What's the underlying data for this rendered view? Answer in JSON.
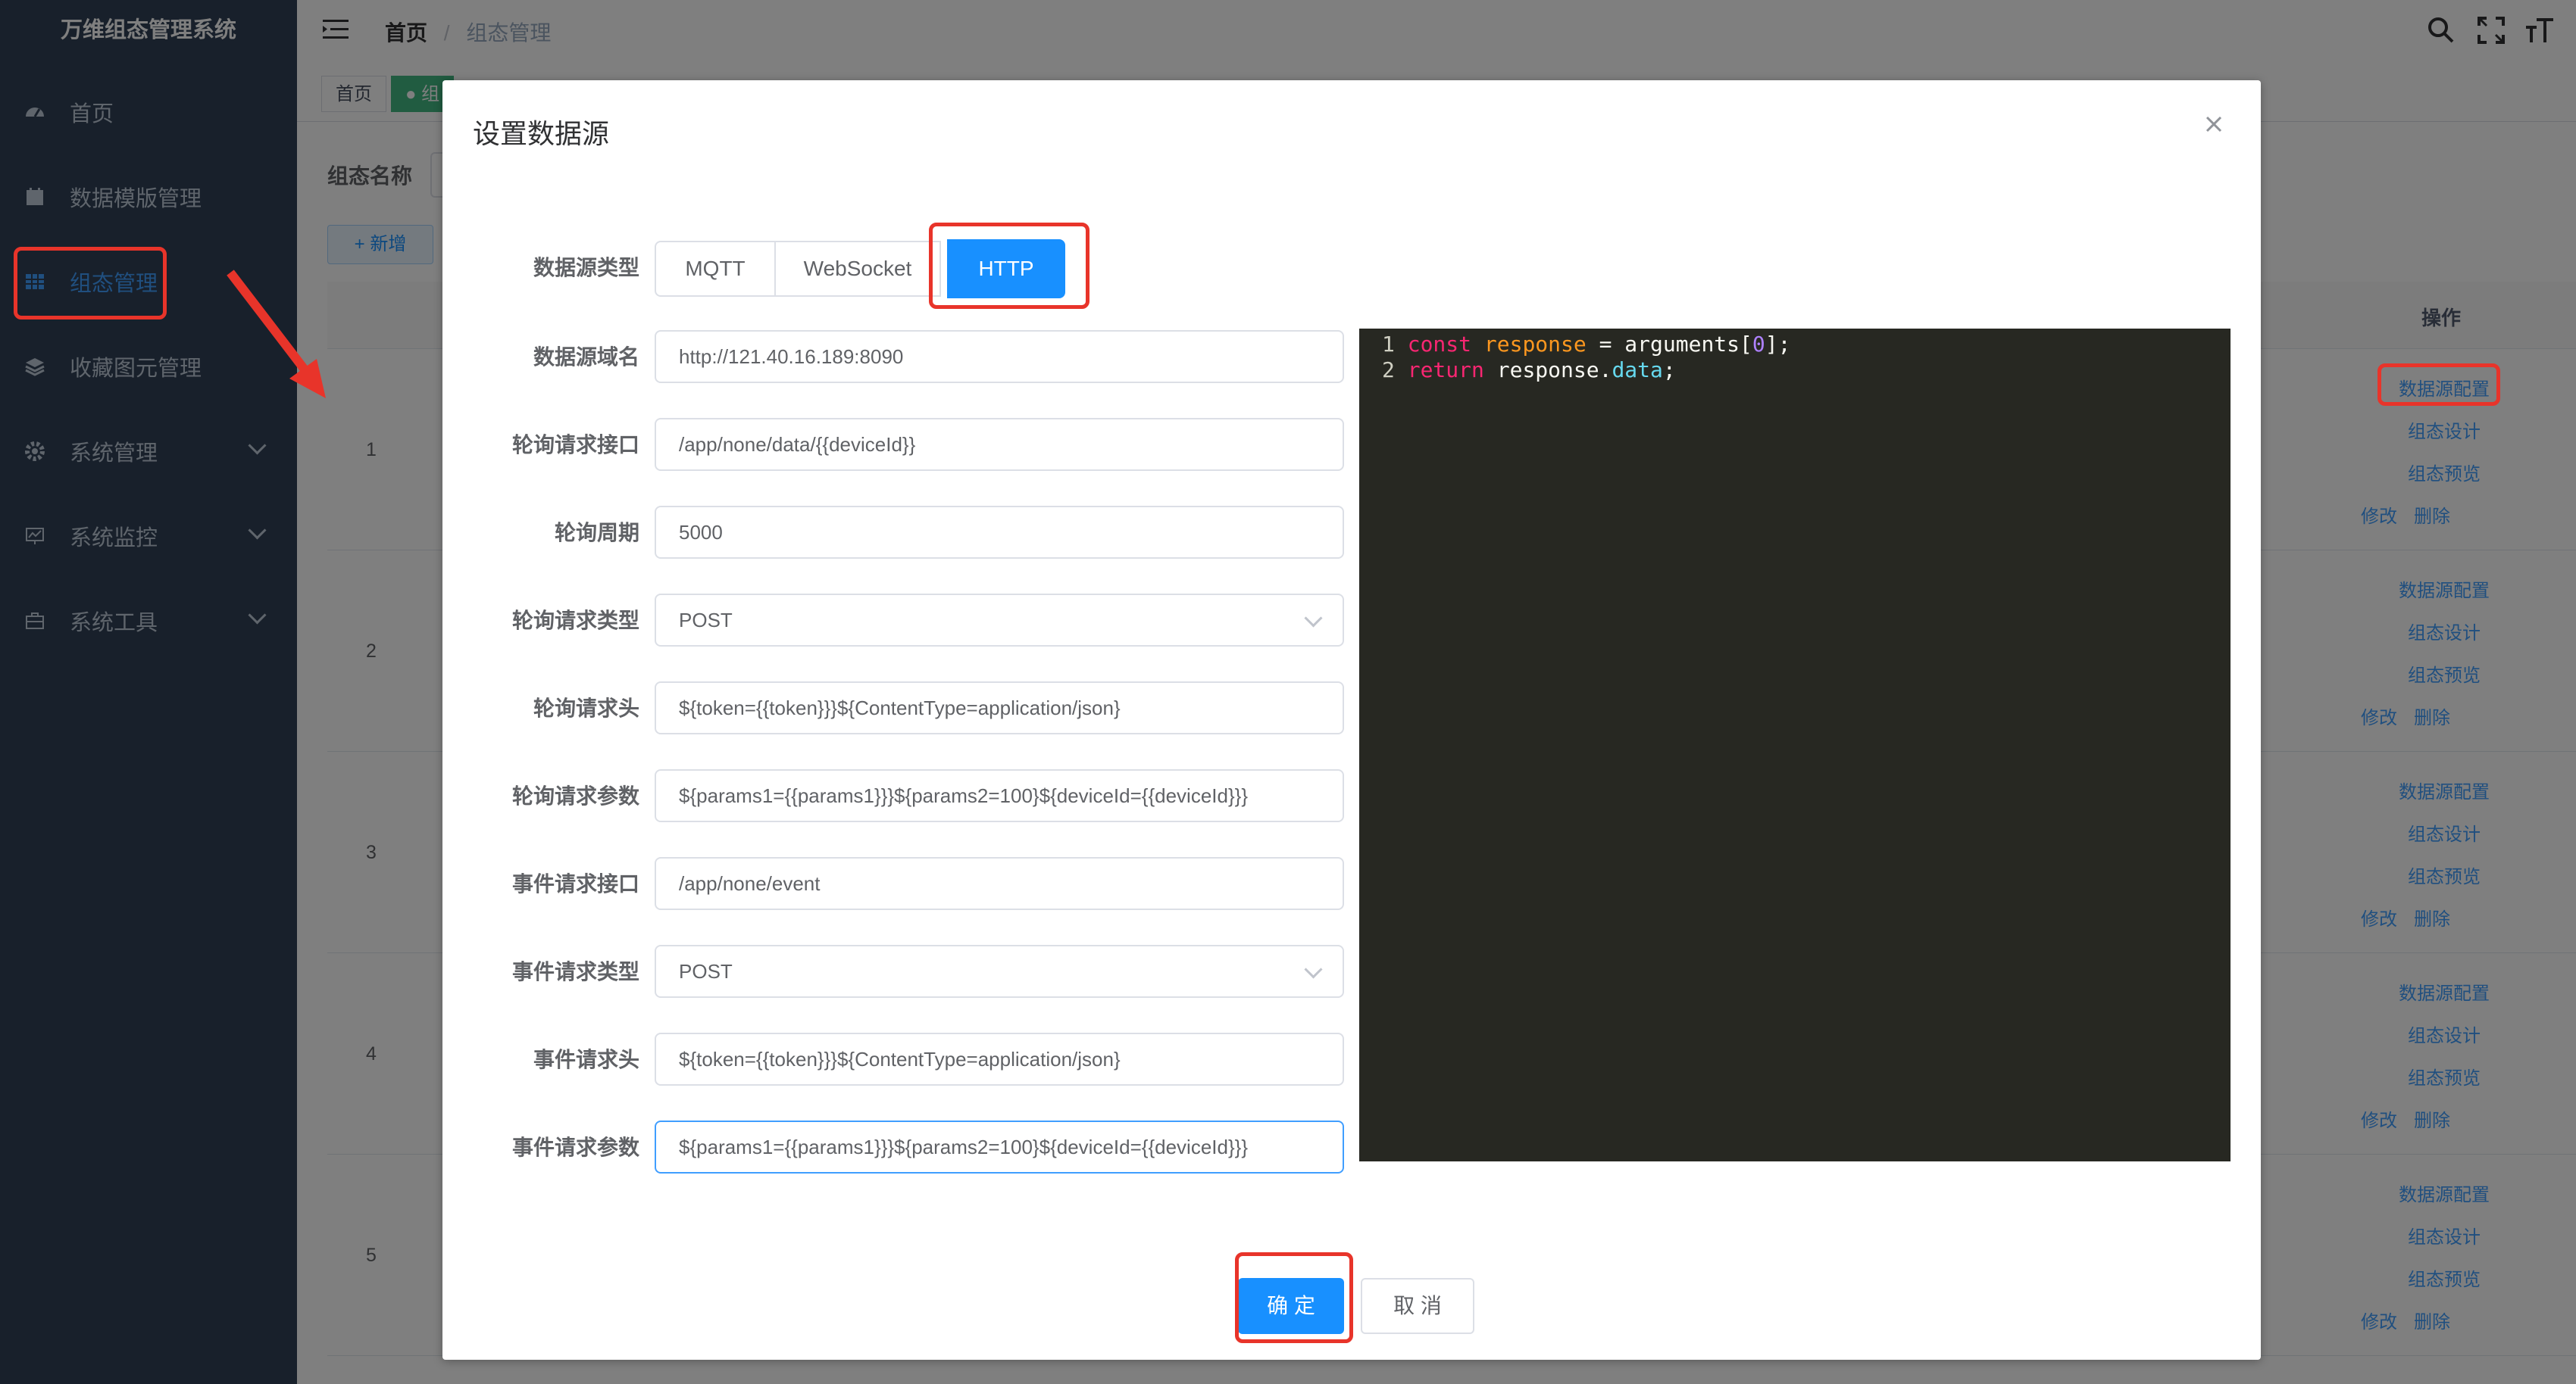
{
  "app": {
    "title": "万维组态管理系统"
  },
  "sidebar": {
    "items": [
      {
        "label": "首页",
        "icon": "dashboard-icon"
      },
      {
        "label": "数据模版管理",
        "icon": "calendar-icon"
      },
      {
        "label": "组态管理",
        "icon": "grid-icon",
        "active": true
      },
      {
        "label": "收藏图元管理",
        "icon": "layers-icon"
      },
      {
        "label": "系统管理",
        "icon": "gear-icon"
      },
      {
        "label": "系统监控",
        "icon": "monitor-icon"
      },
      {
        "label": "系统工具",
        "icon": "toolbox-icon"
      }
    ]
  },
  "header": {
    "breadcrumb": [
      "首页",
      "/",
      "组态管理"
    ]
  },
  "tags": {
    "home": "首页",
    "current": "组"
  },
  "search": {
    "label": "组态名称"
  },
  "toolbar": {
    "add_label": "+ 新增"
  },
  "table": {
    "op_header": "操作",
    "rows": [
      {
        "num": "1",
        "ops": [
          "数据源配置",
          "组态设计",
          "组态预览",
          "修改",
          "删除"
        ]
      },
      {
        "num": "2",
        "ops": [
          "数据源配置",
          "组态设计",
          "组态预览",
          "修改",
          "删除"
        ]
      },
      {
        "num": "3",
        "ops": [
          "数据源配置",
          "组态设计",
          "组态预览",
          "修改",
          "删除"
        ]
      },
      {
        "num": "4",
        "ops": [
          "数据源配置",
          "组态设计",
          "组态预览",
          "修改",
          "删除"
        ]
      },
      {
        "num": "5",
        "ops": [
          "数据源配置",
          "组态设计",
          "组态预览",
          "修改",
          "删除"
        ]
      }
    ]
  },
  "dialog": {
    "title": "设置数据源",
    "type_label": "数据源类型",
    "types": [
      "MQTT",
      "WebSocket",
      "HTTP"
    ],
    "selected_type": "HTTP",
    "fields": [
      {
        "label": "数据源域名",
        "value": "http://121.40.16.189:8090"
      },
      {
        "label": "轮询请求接口",
        "value": "/app/none/data/{{deviceId}}"
      },
      {
        "label": "轮询周期",
        "value": "5000"
      },
      {
        "label": "轮询请求类型",
        "value": "POST"
      },
      {
        "label": "轮询请求头",
        "value": "${token={{token}}}${ContentType=application/json}"
      },
      {
        "label": "轮询请求参数",
        "value": "${params1={{params1}}}${params2=100}${deviceId={{deviceId}}}"
      },
      {
        "label": "事件请求接口",
        "value": "/app/none/event"
      },
      {
        "label": "事件请求类型",
        "value": "POST"
      },
      {
        "label": "事件请求头",
        "value": "${token={{token}}}${ContentType=application/json}"
      },
      {
        "label": "事件请求参数",
        "value": "${params1={{params1}}}${params2=100}${deviceId={{deviceId}}}"
      }
    ],
    "code": {
      "line1": {
        "num": "1",
        "kw": "const",
        "var": "response",
        "rest": " = arguments[",
        "idx": "0",
        "end": "];"
      },
      "line2": {
        "num": "2",
        "kw": "return",
        "obj": " response.",
        "prop": "data",
        "end": ";"
      }
    },
    "ok_label": "确 定",
    "cancel_label": "取 消"
  },
  "colors": {
    "sidebar": "#304156",
    "accent": "#1890ff",
    "highlight": "#e8342a",
    "editor": "#272822"
  }
}
